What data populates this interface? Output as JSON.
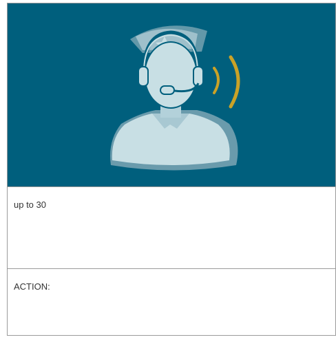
{
  "colors": {
    "hero_background": "#005f7d",
    "figure_light": "#c8dfe4",
    "figure_mid": "#7ca6b4",
    "signal_gold": "#c9a227",
    "border": "#9a9a9a"
  },
  "hero": {
    "icon": "dispatcher-headset-icon"
  },
  "rows": [
    {
      "text": "up to 30"
    },
    {
      "text": "ACTION:"
    }
  ]
}
